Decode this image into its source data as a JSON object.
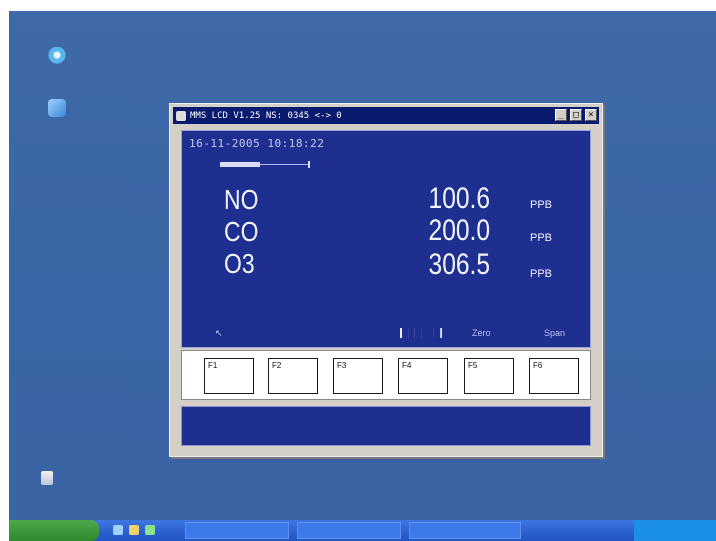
{
  "window": {
    "title": "MMS LCD V1.25 NS: 0345 <-> 0"
  },
  "display": {
    "datetime": "16-11-2005 10:18:22",
    "progress_fraction": 0.45,
    "readings": [
      {
        "gas": "NO",
        "value": "100.6",
        "unit": "PPB"
      },
      {
        "gas": "CO",
        "value": "200.0",
        "unit": "PPB"
      },
      {
        "gas": "O3",
        "value": "306.5",
        "unit": "PPB"
      }
    ],
    "softkeys": {
      "zero": "Zero",
      "span": "Span"
    }
  },
  "fkeys": [
    "F1",
    "F2",
    "F3",
    "F4",
    "F5",
    "F6"
  ],
  "colors": {
    "desktop": "#3a65a6",
    "lcd_background": "#1f2f8f",
    "title_bar": "#0a1a6e"
  },
  "icons": {
    "desktop": [
      "my-computer-icon",
      "network-icon",
      "recycle-bin-icon"
    ],
    "title": "app-icon"
  }
}
